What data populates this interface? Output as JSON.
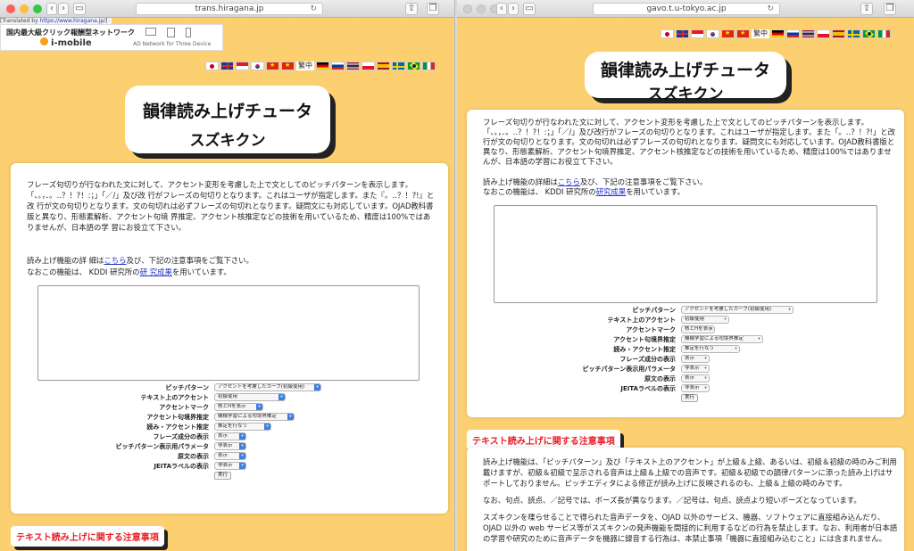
{
  "left": {
    "url": "trans.hiragana.jp",
    "translated_prefix": "[Translated by ",
    "translated_link": "https://www.hiragana.jp/",
    "translated_suffix": "]",
    "ad_title": "国内最大級クリック報酬型ネットワーク",
    "ad_logo": "i-mobile",
    "ad_tagline": "AD Network for Three Device",
    "title_line1": "韻律読み上げチュータ",
    "title_line2": "スズキクン",
    "para1": "フレーズ句切りが行なわれた文に対して、アクセント変形を考慮した上で文としてのピッチパターンを表示します。「、。，．。‥？！?！:；」「／/」及び改 行がフレーズの句切りとなります。これはユーザが指定します。また『。‥？！?!』と改 行が文の句切りとなります。文の句切れは必ずフレーズの句切れとなります。疑問文にも対応しています。OJAD教科書版と異なり、形態素解析、アクセント句境 界推定、アクセント核推定などの技術を用いているため、精度は100%ではありませんが、日本語の学 習にお役立て下さい。",
    "para2_pre": "読み上げ機能の詳 細は",
    "para2_link": "こちら",
    "para2_post": "及び、下記の注意事項をご覧下さい。",
    "para3_pre": "なおこの機能は、 KDDI 研究所の",
    "para3_link": "研 究成果",
    "para3_post": "を用いています。",
    "section_header": "テキスト読み上げに関する注意事項"
  },
  "right": {
    "url": "gavo.t.u-tokyo.ac.jp",
    "title_line1": "韻律読み上げチュータ",
    "title_line2": "スズキクン",
    "para1": "フレーズ句切りが行なわれた文に対して、アクセント変形を考慮した上で文としてのピッチパターンを表示します。「、。，．。‥？！?！:；」「／/」及び改行がフレーズの句切りとなります。これはユーザが指定します。また「。‥？！?!」と改行が文の句切りとなります。文の句切れは必ずフレーズの句切れとなります。疑問文にも対応しています。OJAD教科書版と異なり、形態素解析、アクセント句境界推定、アクセント核推定などの技術を用いているため、精度は100%ではありませんが、日本語の学習にお役立て下さい。",
    "para2_pre": "読み上げ機能の詳細は",
    "para2_link": "こちら",
    "para2_post": "及び、下記の注意事項をご覧下さい。",
    "para3_pre": "なおこの機能は、 KDDI 研究所の",
    "para3_link": "研究成果",
    "para3_post": "を用いています。",
    "section_header": "テキスト読み上げに関する注意事項",
    "notice1": "読み上げ機能は、「ピッチパターン」及び「テキスト上のアクセント」が上級＆上級、あるいは、初級＆初級の時のみご利用戴けますが、初級＆初級で呈示される音声は上級＆上級での音声です。初級＆初級での韻律パターンに添った読み上げはサポートしておりません。ピッチエディタによる修正が読み上げに反映されるのも、上級＆上級の時のみです。",
    "notice2": "なお、句点、読点、／記号では、ポーズ長が異なります。／記号は、句点、読点より短いポーズとなっています。",
    "notice3": "スズキクンを喋らせることで得られた音声データを、OJAD 以外のサービス、機器、ソフトウェアに直接組み込んだり、OJAD 以外の web サービス等がスズキクンの発声機能を間接的に利用するなどの行為を禁止します。なお、利用者が日本語の学習や研究のために音声データを機器に録音する行為は、本禁止事項「機器に直接組み込むこと」には含まれません。"
  },
  "form": {
    "labels": [
      "ピッチパターン",
      "テキスト上のアクセント",
      "アクセントマーク",
      "アクセント句境界推定",
      "読み・アクセント推定",
      "フレーズ成分の表示",
      "ピッチパターン表示用パラメータ",
      "原文の表示",
      "JEITAラベルの表示"
    ],
    "values": [
      "アクセントを考慮したカーブ(初級使用)",
      "初級使用",
      "核とHを表示",
      "機械学習による句境界推定",
      "推定を行なう",
      "表示",
      "非表示",
      "表示",
      "非表示"
    ],
    "run_label": "実行"
  },
  "flags": [
    "Japanese",
    "English",
    "Indonesian",
    "Korean",
    "Chinese (Simplified)",
    "Vietnamese",
    "Chinese (Traditional)",
    "German",
    "Russian",
    "Thai",
    "Polish",
    "Spanish",
    "Swedish",
    "Portuguese (Brazil)",
    "Italian"
  ],
  "flag_text": "繁中",
  "colors": {
    "page_bg": "#fcd071",
    "section_red": "#e8212a",
    "select_blue": "#3f7fe0"
  }
}
